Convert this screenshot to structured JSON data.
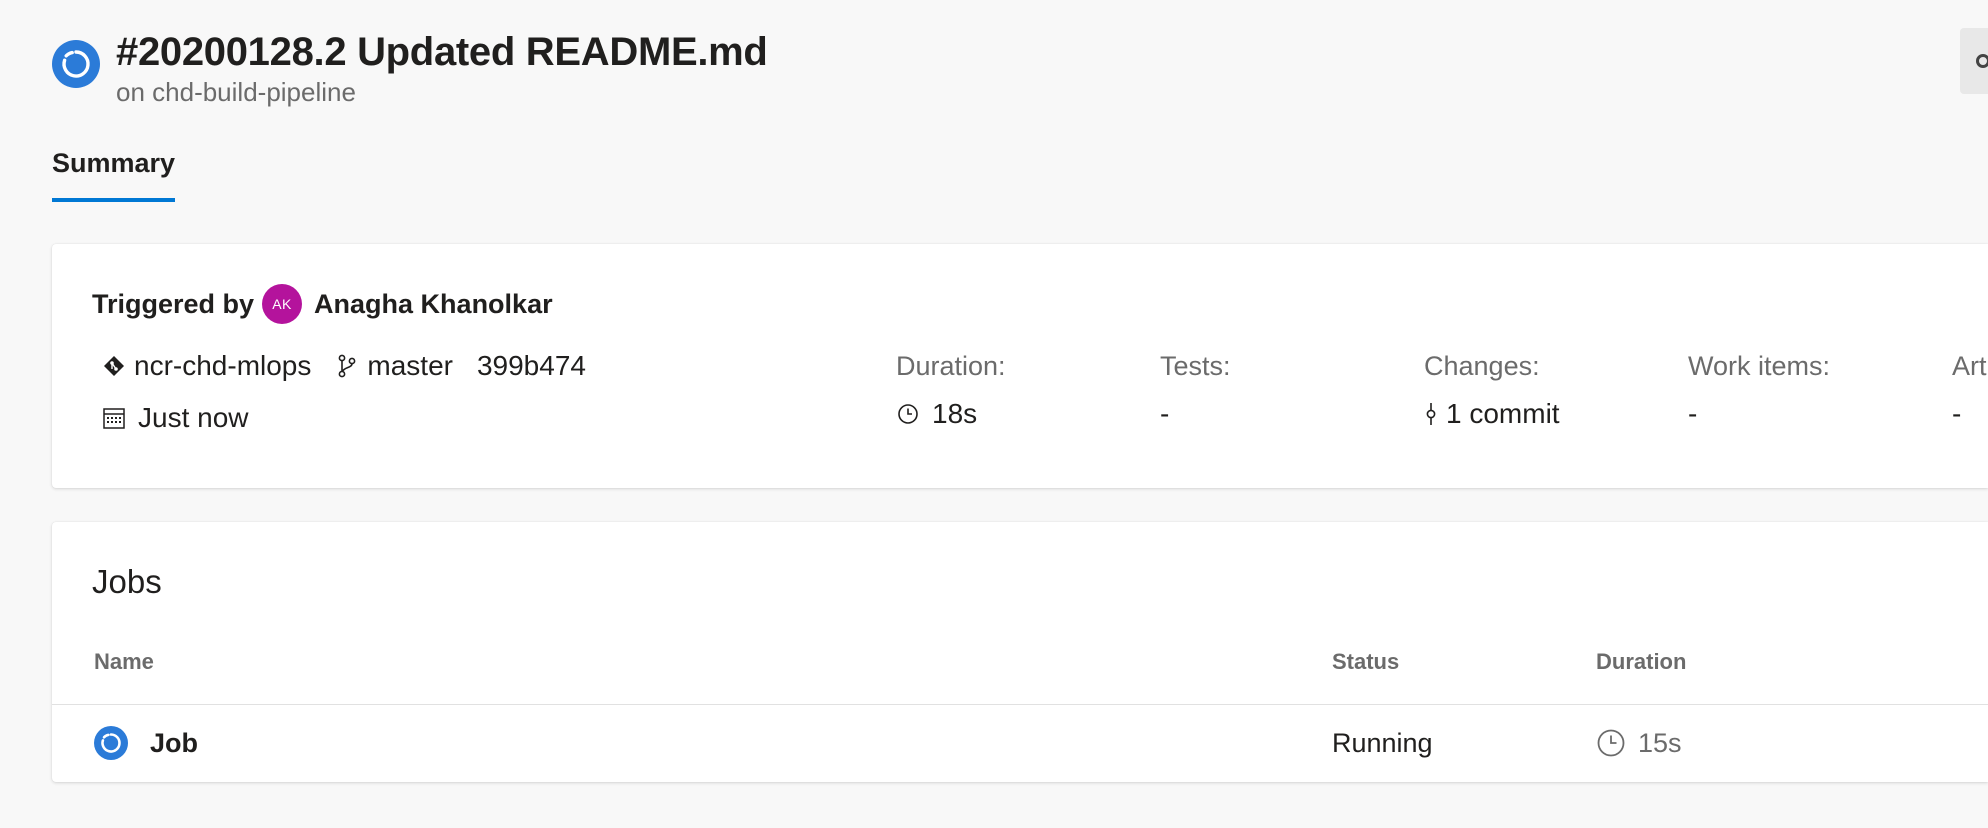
{
  "header": {
    "title": "#20200128.2 Updated README.md",
    "subtitle": "on chd-build-pipeline",
    "status_icon": "running-status-icon",
    "action_icon": "more-icon"
  },
  "tabs": [
    {
      "label": "Summary",
      "selected": true
    }
  ],
  "summary": {
    "triggered_label": "Triggered by",
    "user": {
      "initials": "AK",
      "name": "Anagha Khanolkar",
      "avatar_color": "#b4139c"
    },
    "repo": {
      "icon": "repo-icon",
      "name": "ncr-chd-mlops"
    },
    "branch": {
      "icon": "branch-icon",
      "name": "master"
    },
    "commit_id": "399b474",
    "time": {
      "icon": "calendar-icon",
      "text": "Just now"
    },
    "stats": [
      {
        "label": "Duration:",
        "value": "18s",
        "icon": "clock-icon"
      },
      {
        "label": "Tests:",
        "value": "-"
      },
      {
        "label": "Changes:",
        "value": "1 commit",
        "icon": "commit-icon"
      },
      {
        "label": "Work items:",
        "value": "-"
      },
      {
        "label": "Art",
        "value": "-"
      }
    ]
  },
  "jobs": {
    "title": "Jobs",
    "columns": [
      "Name",
      "Status",
      "Duration"
    ],
    "rows": [
      {
        "name": "Job",
        "status": "Running",
        "duration": "15s",
        "status_icon": "running-status-icon"
      }
    ]
  },
  "colors": {
    "accent": "#0078d4",
    "status_running": "#2b7bd8",
    "background": "#f8f8f8",
    "avatar": "#b4139c"
  }
}
